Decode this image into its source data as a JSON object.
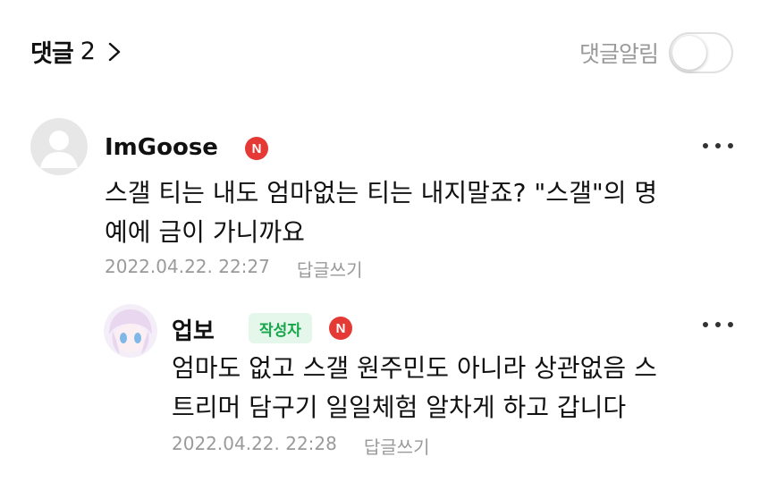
{
  "header": {
    "title": "댓글",
    "count": "2",
    "chevron_icon": "chevron-right-icon",
    "notify_label": "댓글알림",
    "notify_enabled": false
  },
  "comments": [
    {
      "author": "ImGoose",
      "badge": "N",
      "text_line1": "스갤 티는 내도 엄마없는 티는 내지말죠? \"스갤\"의 명",
      "text_line2": "예에 금이 가니까요",
      "date": "2022.04.22. 22:27",
      "reply_label": "답글쓰기",
      "more_icon": "more-dots-icon"
    },
    {
      "author": "업보",
      "author_badge": "작성자",
      "badge": "N",
      "text_line1": "엄마도 없고 스갤 원주민도 아니라 상관없음 스",
      "text_line2": "트리머 담구기 일일체험 알차게 하고 갑니다",
      "date": "2022.04.22. 22:28",
      "reply_label": "답글쓰기",
      "more_icon": "more-dots-icon"
    }
  ],
  "colors": {
    "new_badge": "#e53935",
    "author_badge_bg": "#e4f7ea",
    "author_badge_text": "#15a64a",
    "meta_text": "#9a9a9a"
  }
}
